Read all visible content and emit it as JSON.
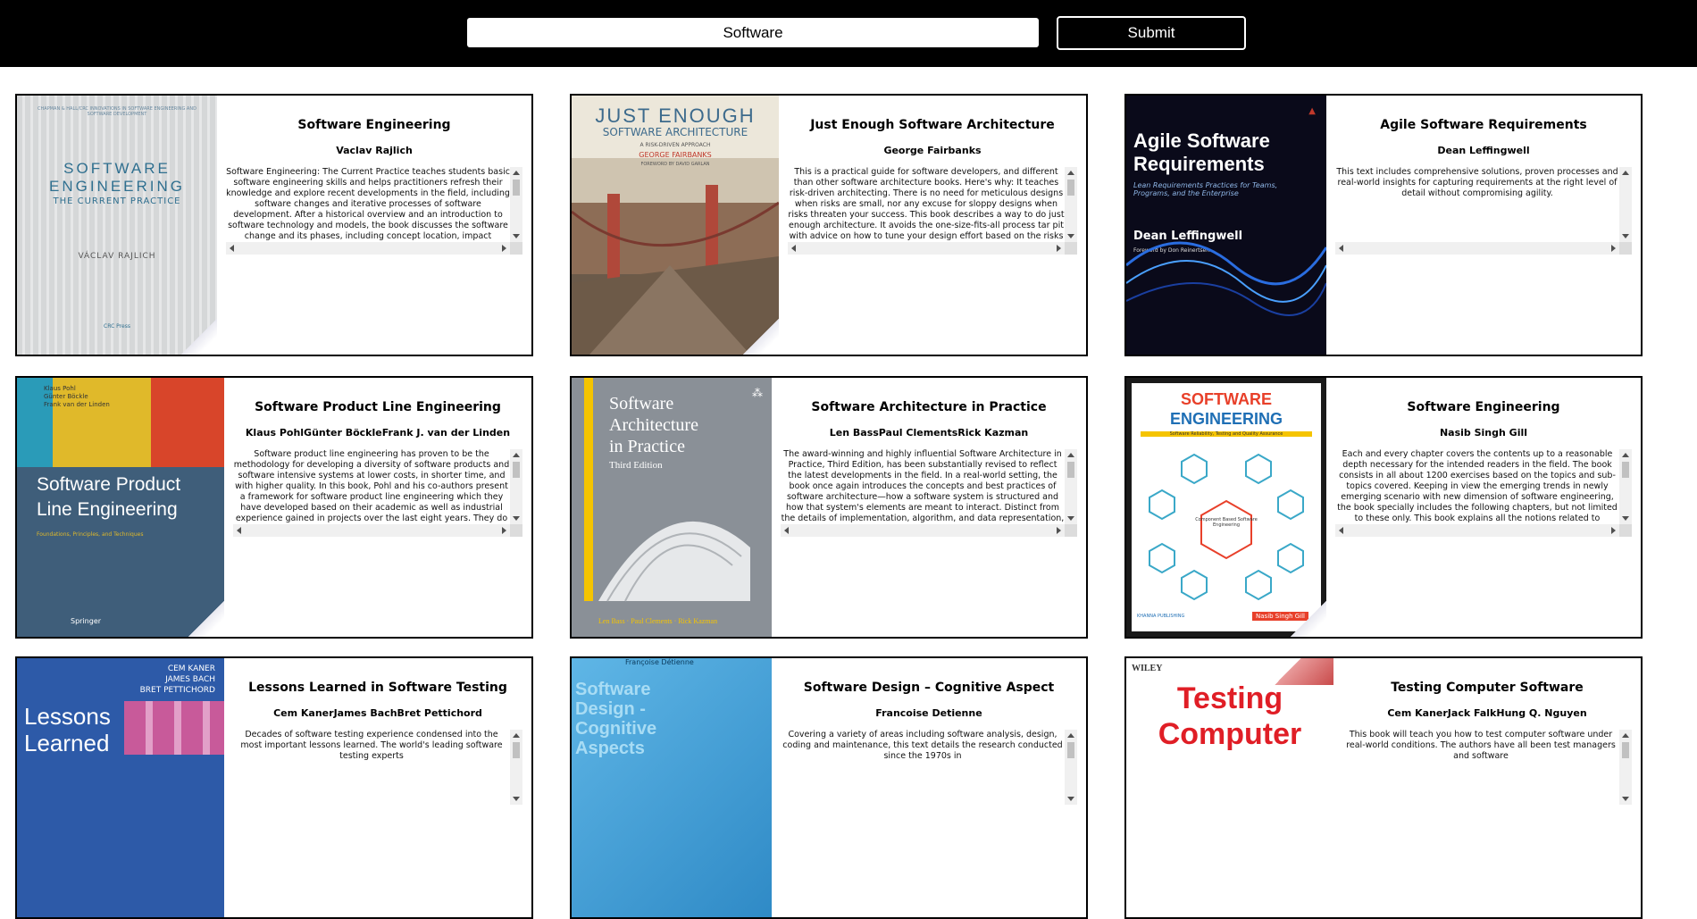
{
  "search": {
    "value": "Software"
  },
  "submit_label": "Submit",
  "books": [
    {
      "title": "Software Engineering",
      "authors": "Vaclav Rajlich",
      "description": "Software Engineering: The Current Practice teaches students basic software engineering skills and helps practitioners refresh their knowledge and explore recent developments in the field, including software changes and iterative processes of software development. After a historical overview and an introduction to software technology and models, the book discusses the software change and its phases, including concept location, impact analysis, refactoring, actualization, and verification. It then",
      "cover": {
        "top": "CHAPMAN & HALL/CRC INNOVATIONS IN SOFTWARE ENGINEERING AND SOFTWARE DEVELOPMENT",
        "line1": "SOFTWARE",
        "line2": "ENGINEERING",
        "line3": "THE CURRENT PRACTICE",
        "author": "VÁCLAV RAJLICH",
        "publisher": "CRC Press",
        "bg": "#d9dbdc",
        "fg": "#2f6f8f"
      }
    },
    {
      "title": "Just Enough Software Architecture",
      "authors": "George Fairbanks",
      "description": "This is a practical guide for software developers, and different than other software architecture books. Here's why: It teaches risk-driven architecting. There is no need for meticulous designs when risks are small, nor any excuse for sloppy designs when risks threaten your success. This book describes a way to do just enough architecture. It avoids the one-size-fits-all process tar pit with advice on how to tune your design effort based on the risks you face. It democratizes",
      "cover": {
        "line1": "JUST ENOUGH",
        "line2": "SOFTWARE ARCHITECTURE",
        "line3": "A RISK-DRIVEN APPROACH",
        "author": "GEORGE FAIRBANKS",
        "foreword": "FOREWORD BY DAVID GARLAN",
        "bg": "#e9e4d6",
        "fg": "#3c6a8c",
        "accent": "#c0392b"
      }
    },
    {
      "title": "Agile Software Requirements",
      "authors": "Dean Leffingwell",
      "description": "This text includes comprehensive solutions, proven processes and real-world insights for capturing requirements at the right level of detail without compromising agility.",
      "cover": {
        "line1": "Agile Software",
        "line2": "Requirements",
        "line3": "Lean Requirements Practices for Teams, Programs, and the Enterprise",
        "author": "Dean Leffingwell",
        "foreword": "Foreword by Don Reinertsen",
        "bg": "#0a0a1a",
        "fg": "#ffffff"
      }
    },
    {
      "title": "Software Product Line Engineering",
      "authors": "Klaus PohlGünter BöckleFrank J. van der Linden",
      "description": "Software product line engineering has proven to be the methodology for developing a diversity of software products and software intensive systems at lower costs, in shorter time, and with higher quality. In this book, Pohl and his co-authors present a framework for software product line engineering which they have developed based on their academic as well as industrial experience gained in projects over the last eight years. They do not only detail the technical aspect of the development, but",
      "cover": {
        "top": "Klaus Pohl\nGünter Böckle\nFrank van der Linden",
        "line1": "Software Product",
        "line2": "Line Engineering",
        "line3": "Foundations, Principles, and Techniques",
        "publisher": "Springer",
        "bg": "#3f5e7a",
        "fg": "#ffffff"
      }
    },
    {
      "title": "Software Architecture in Practice",
      "authors": "Len BassPaul ClementsRick Kazman",
      "description": "The award-winning and highly influential Software Architecture in Practice, Third Edition, has been substantially revised to reflect the latest developments in the field. In a real-world setting, the book once again introduces the concepts and best practices of software architecture—how a software system is structured and how that system's elements are meant to interact. Distinct from the details of implementation, algorithm, and data representation, an architecture holds the key to achieving system",
      "cover": {
        "line1": "Software",
        "line2": "Architecture",
        "line3": "in Practice",
        "edition": "Third Edition",
        "author": "Len Bass · Paul Clements · Rick Kazman",
        "bg": "#8a9097",
        "fg": "#ffffff",
        "accent": "#f5c400"
      }
    },
    {
      "title": "Software Engineering",
      "authors": "Nasib Singh Gill",
      "description": "Each and every chapter covers the contents up to a reasonable depth necessary for the intended readers in the field. The book consists in all about 1200 exercises based on the topics and sub-topics covered. Keeping in view the emerging trends in newly emerging scenario with new dimension of software engineering, the book specially includes the following chapters, but not limited to these only. This book explains all the notions related to software engineering in a very systematic way, which is",
      "cover": {
        "line1": "SOFTWARE",
        "line2": "ENGINEERING",
        "line3": "Software Reliability, Testing and Quality Assurance",
        "center": "Component Based Software Engineering",
        "author": "Nasib Singh Gill",
        "publisher": "KHANNA PUBLISHING",
        "bg": "#ffffff",
        "fg": "#e8402a",
        "accent": "#3aa8c8"
      }
    },
    {
      "title": "Lessons Learned in Software Testing",
      "authors": "Cem KanerJames BachBret Pettichord",
      "description": "Decades of software testing experience condensed into the most important lessons learned. The world's leading software testing experts",
      "cover": {
        "top": "CEM KANER\nJAMES BACH\nBRET PETTICHORD",
        "line1": "Lessons",
        "line2": "Learned",
        "bg": "#2d5aa8",
        "fg": "#ffffff"
      }
    },
    {
      "title": "Software Design – Cognitive Aspect",
      "authors": "Francoise Detienne",
      "description": "Covering a variety of areas including software analysis, design, coding and maintenance, this text details the research conducted since the 1970s in",
      "cover": {
        "top": "Françoise Détienne",
        "line1": "Software",
        "line2": "Design -",
        "line3": "Cognitive",
        "line4": "Aspects",
        "bg": "#3f9fd6",
        "fg": "#9fd4f0"
      }
    },
    {
      "title": "Testing Computer Software",
      "authors": "Cem KanerJack FalkHung Q. Nguyen",
      "description": "This book will teach you how to test computer software under real-world conditions. The authors have all been test managers and software",
      "cover": {
        "top": "WILEY",
        "line1": "Testing",
        "line2": "Computer",
        "bg": "#ffffff",
        "fg": "#e01e26"
      }
    }
  ]
}
